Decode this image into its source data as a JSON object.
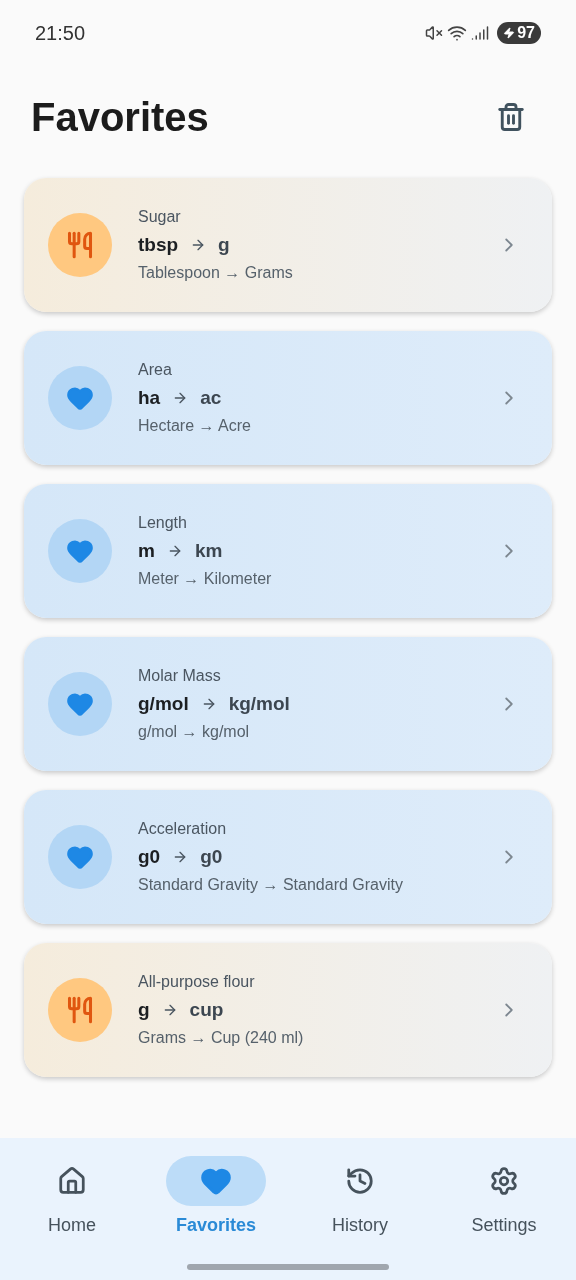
{
  "status_bar": {
    "time": "21:50",
    "battery": "97"
  },
  "title": "Favorites",
  "favorites": [
    {
      "kind": "food",
      "category": "Sugar",
      "from": "tbsp",
      "to": "g",
      "description": "Tablespoon → Grams"
    },
    {
      "kind": "favorite",
      "category": "Area",
      "from": "ha",
      "to": "ac",
      "description": "Hectare → Acre"
    },
    {
      "kind": "favorite",
      "category": "Length",
      "from": "m",
      "to": "km",
      "description": "Meter → Kilometer"
    },
    {
      "kind": "favorite",
      "category": "Molar Mass",
      "from": "g/mol",
      "to": "kg/mol",
      "description": "g/mol → kg/mol"
    },
    {
      "kind": "favorite",
      "category": "Acceleration",
      "from": "g0",
      "to": "g0",
      "description": "Standard Gravity → Standard Gravity"
    },
    {
      "kind": "food",
      "category": "All-purpose flour",
      "from": "g",
      "to": "cup",
      "description": "Grams → Cup (240 ml)"
    }
  ],
  "nav": [
    {
      "kind": "home",
      "label": "Home",
      "selected": false
    },
    {
      "kind": "favorites",
      "label": "Favorites",
      "selected": true
    },
    {
      "kind": "history",
      "label": "History",
      "selected": false
    },
    {
      "kind": "settings",
      "label": "Settings",
      "selected": false
    }
  ]
}
